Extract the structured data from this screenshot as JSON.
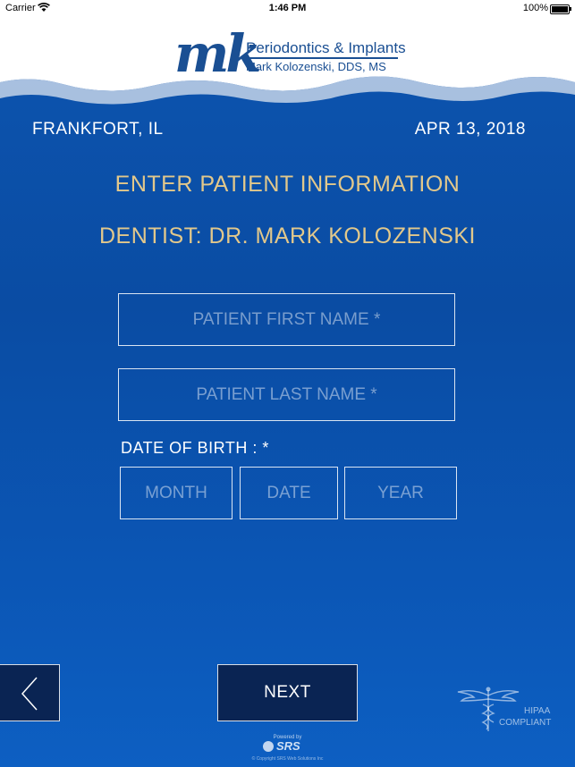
{
  "status_bar": {
    "carrier": "Carrier",
    "time": "1:46 PM",
    "battery": "100%"
  },
  "logo": {
    "mark": "mk",
    "practice_name": "Periodontics & Implants",
    "doctor_credentials": "Mark Kolozenski, DDS, MS"
  },
  "info": {
    "location": "FRANKFORT, IL",
    "date": "APR 13, 2018",
    "title": "ENTER PATIENT INFORMATION",
    "dentist": "DENTIST: DR. MARK KOLOZENSKI"
  },
  "form": {
    "first_name_placeholder": "PATIENT FIRST NAME *",
    "last_name_placeholder": "PATIENT LAST NAME *",
    "dob_label": "DATE OF BIRTH : *",
    "month_placeholder": "MONTH",
    "date_placeholder": "DATE",
    "year_placeholder": "YEAR"
  },
  "nav": {
    "next_label": "NEXT",
    "back_icon": "chevron-left-icon"
  },
  "hipaa": {
    "line1": "HIPAA",
    "line2": "COMPLIANT",
    "icon": "caduceus-icon"
  },
  "footer": {
    "powered_by": "Powered by",
    "brand": "SRS",
    "copyright": "© Copyright SRS Web Solutions Inc"
  },
  "colors": {
    "background": "#0b52ad",
    "accent_gold": "#e2c88b",
    "button_dark": "#0a2453",
    "logo_blue": "#1a4f93"
  }
}
